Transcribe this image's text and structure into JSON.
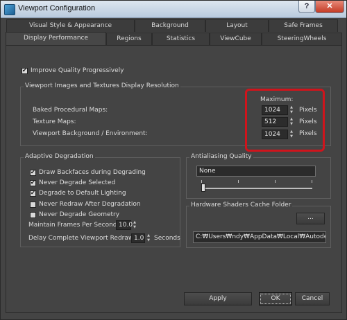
{
  "window": {
    "title": "Viewport Configuration",
    "help_label": "?",
    "close_label": "✕"
  },
  "tabs_row1": [
    "Visual Style & Appearance",
    "Background",
    "Layout",
    "Safe Frames"
  ],
  "tabs_row2": [
    "Display Performance",
    "Regions",
    "Statistics",
    "ViewCube",
    "SteeringWheels"
  ],
  "active_tab": "Display Performance",
  "improve_quality": {
    "label": "Improve Quality Progressively",
    "checked": true
  },
  "resolution": {
    "title": "Viewport Images and Textures Display Resolution",
    "maximum_label": "Maximum:",
    "rows": [
      {
        "label": "Baked Procedural Maps:",
        "value": "1024",
        "unit": "Pixels"
      },
      {
        "label": "Texture Maps:",
        "value": "512",
        "unit": "Pixels"
      },
      {
        "label": "Viewport Background / Environment:",
        "value": "1024",
        "unit": "Pixels"
      }
    ]
  },
  "adaptive": {
    "title": "Adaptive Degradation",
    "options": [
      {
        "label": "Draw Backfaces during Degrading",
        "checked": true
      },
      {
        "label": "Never Degrade Selected",
        "checked": true
      },
      {
        "label": "Degrade to Default Lighting",
        "checked": true
      },
      {
        "label": "Never Redraw After Degradation",
        "checked": false
      },
      {
        "label": "Never Degrade Geometry",
        "checked": false
      }
    ],
    "maintain_fps_label": "Maintain Frames Per Second:",
    "maintain_fps_value": "10.0",
    "delay_label": "Delay Complete Viewport Redraw in",
    "delay_value": "1.0",
    "delay_unit": "Seconds"
  },
  "antialiasing": {
    "title": "Antialiasing Quality",
    "value": "None",
    "slider_fraction": 0.0
  },
  "shader_cache": {
    "title": "Hardware Shaders Cache Folder",
    "browse_label": "...",
    "path": "C:₩Users₩ndy₩AppData₩Local₩Autodesk"
  },
  "buttons": {
    "apply": "Apply",
    "ok": "OK",
    "cancel": "Cancel"
  },
  "colors": {
    "highlight": "#d0141c",
    "panel_bg": "#444444",
    "title_bar": "#c9d6e4"
  }
}
